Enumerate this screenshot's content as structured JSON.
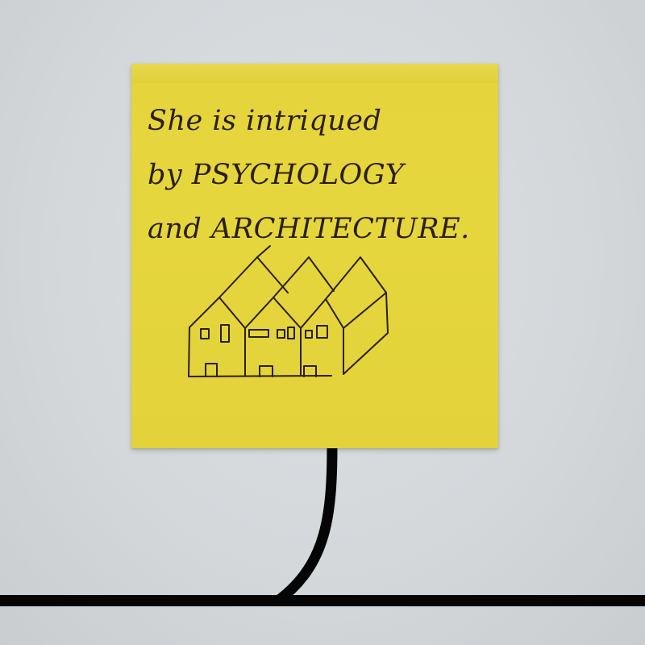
{
  "note": {
    "lines": [
      "She is intriqued",
      "by PSYCHOLOGY",
      "and ARCHITECTURE."
    ],
    "color": "#e5d43a",
    "ink_color": "#2a1f0c"
  },
  "sketch": {
    "subject": "row-of-houses-drawing",
    "house_count": 3
  },
  "cable": {
    "color": "#050505"
  }
}
